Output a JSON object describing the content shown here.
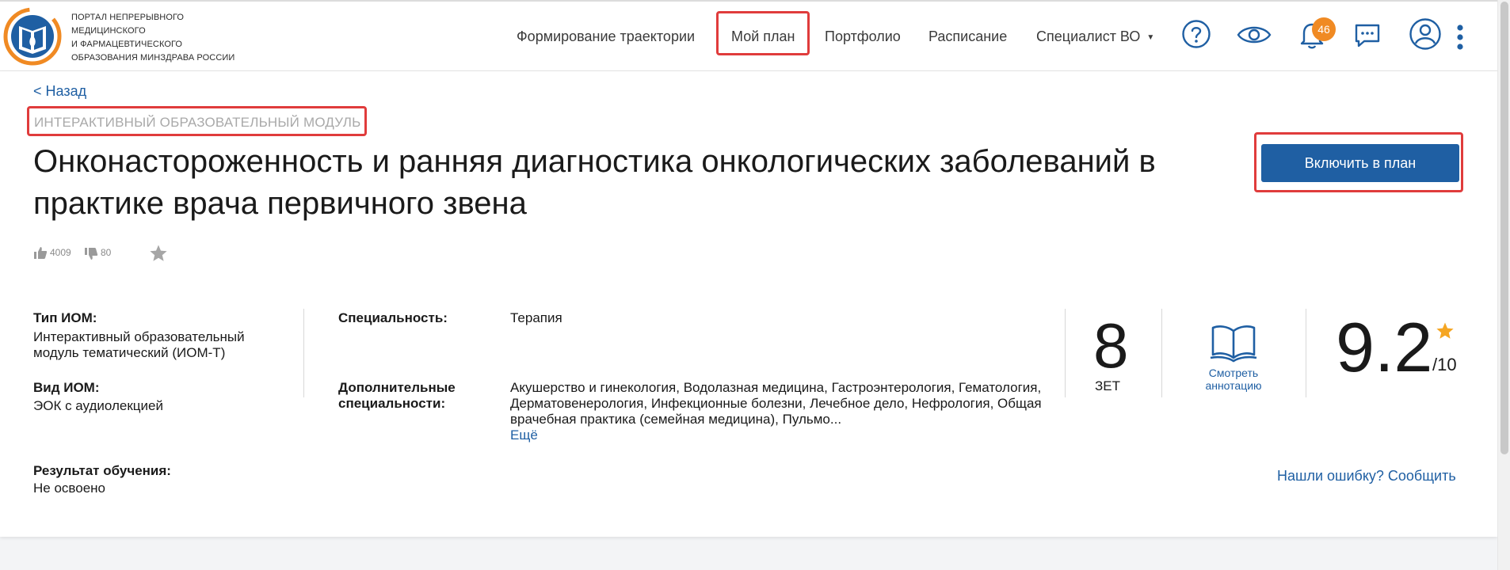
{
  "header": {
    "logo_lines": [
      "Портал непрерывного",
      "медицинского",
      "и фармацевтического",
      "образования Минздрава России"
    ],
    "nav": {
      "trajectory": "Формирование траектории",
      "my_plan": "Мой план",
      "portfolio": "Портфолио",
      "schedule": "Расписание",
      "specialist": "Специалист ВО"
    },
    "notifications_count": "46"
  },
  "page": {
    "back": "< Назад",
    "module_type": "ИНТЕРАКТИВНЫЙ ОБРАЗОВАТЕЛЬНЫЙ МОДУЛЬ",
    "title": "Онконастороженность и ранняя диагностика онкологических заболеваний в практике врача первичного звена",
    "include_button": "Включить в план",
    "likes": "4009",
    "dislikes": "80"
  },
  "details": {
    "iom_type_label": "Тип ИОМ:",
    "iom_type_value": "Интерактивный образовательный модуль тематический (ИОМ-Т)",
    "iom_kind_label": "Вид ИОМ:",
    "iom_kind_value": "ЭОК с аудиолекцией",
    "result_label": "Результат обучения:",
    "result_value": "Не освоено",
    "specialty_label": "Специальность:",
    "specialty_value": "Терапия",
    "extra_label": "Дополнительные специальности:",
    "extra_value": "Акушерство и гинекология, Водолазная медицина, Гастроэнтерология, Гематология, Дерматовенерология, Инфекционные болезни, Лечебное дело, Нефрология, Общая врачебная практика (семейная медицина), Пульмо...",
    "more": "Ещё"
  },
  "stats": {
    "zet_value": "8",
    "zet_label": "ЗЕТ",
    "annotation_label": "Смотреть аннотацию",
    "rating": "9.2",
    "rating_max": "/10"
  },
  "footer": {
    "report_error": "Нашли ошибку? Сообщить"
  },
  "colors": {
    "accent": "#1f5fa3",
    "highlight": "#e03c3c",
    "badge": "#f08a23",
    "rating_star": "#f5a623"
  }
}
